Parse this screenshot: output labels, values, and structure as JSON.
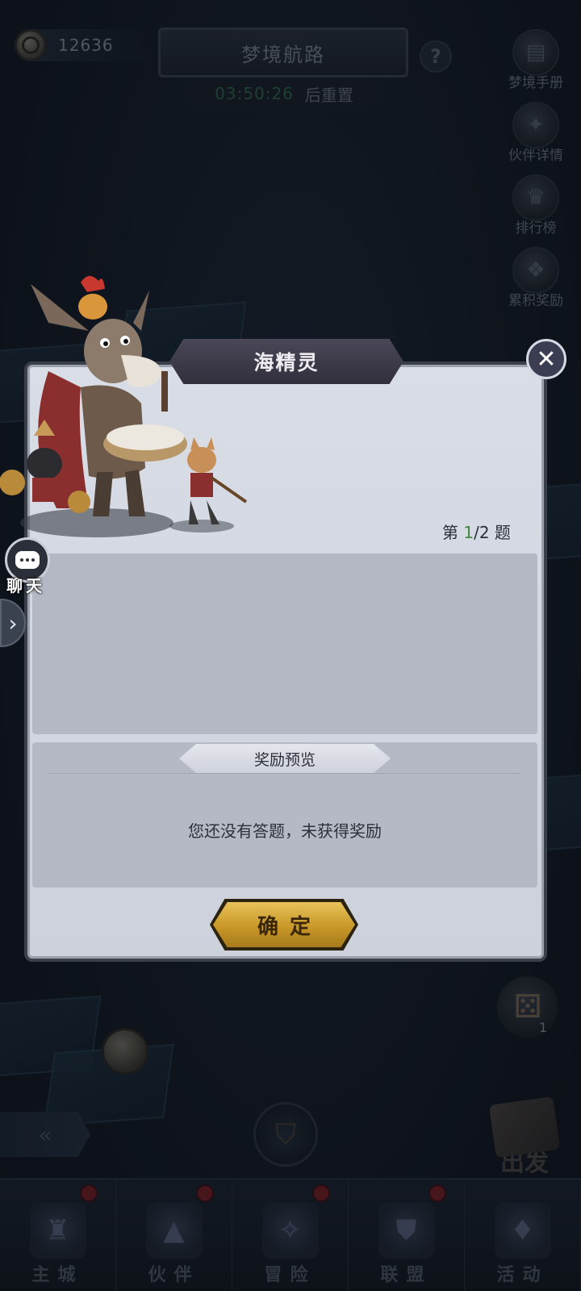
{
  "currency": {
    "amount": "12636"
  },
  "header": {
    "title": "梦境航路",
    "timer": "03:50:26",
    "timer_suffix": "后重置",
    "help_label": "?"
  },
  "side_menu": [
    {
      "label": "梦境手册",
      "icon": "handbook-icon"
    },
    {
      "label": "伙伴详情",
      "icon": "partner-detail-icon"
    },
    {
      "label": "排行榜",
      "icon": "trophy-icon"
    },
    {
      "label": "累积奖励",
      "icon": "gift-icon"
    }
  ],
  "dialog": {
    "title": "海精灵",
    "close_label": "✕",
    "question_prefix": "第 ",
    "question_current": "1",
    "question_total": "/2 题",
    "reward_title": "奖励预览",
    "reward_empty": "您还没有答题，未获得奖励",
    "confirm_label": "确定"
  },
  "chat": {
    "label": "聊天"
  },
  "dice": {
    "count": "1"
  },
  "depart": {
    "label": "出发"
  },
  "bottom_nav": [
    {
      "label": "主城",
      "badge": true,
      "icon": "castle-icon"
    },
    {
      "label": "伙伴",
      "badge": true,
      "icon": "wizard-hat-icon"
    },
    {
      "label": "冒险",
      "badge": true,
      "icon": "compass-icon"
    },
    {
      "label": "联盟",
      "badge": true,
      "icon": "shield-icon"
    },
    {
      "label": "活动",
      "badge": false,
      "icon": "cards-icon"
    }
  ],
  "colors": {
    "dialog_bg": "#d9dde6",
    "confirm_gold": "#c99828",
    "question_current_green": "#3f8a3a",
    "timer_green": "#2f6a4c",
    "badge_red": "#7a1f24"
  }
}
